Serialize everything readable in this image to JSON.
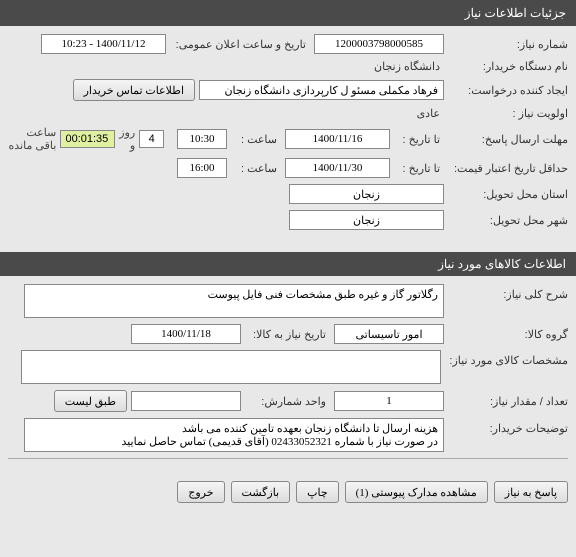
{
  "headers": {
    "main": "جزئیات اطلاعات نیاز",
    "items": "اطلاعات کالاهای مورد نیاز"
  },
  "labels": {
    "need_number": "شماره نیاز:",
    "announce_datetime": "تاریخ و ساعت اعلان عمومی:",
    "buyer_org": "نام دستگاه خریدار:",
    "requester": "ایجاد کننده درخواست:",
    "contact_info": "اطلاعات تماس خریدار",
    "priority": "اولویت نیاز :",
    "response_deadline": "مهلت ارسال پاسخ:",
    "to_date": "تا تاریخ :",
    "time": "ساعت :",
    "remaining_days": "روز و",
    "remaining_time": "ساعت باقی مانده",
    "price_validity": "حداقل تاریخ اعتبار قیمت:",
    "delivery_province": "استان محل تحویل:",
    "delivery_city": "شهر محل تحویل:",
    "need_desc": "شرح کلی نیاز:",
    "item_group": "گروه کالا:",
    "need_date": "تاریخ نیاز به کالا:",
    "item_specs": "مشخصات کالای مورد نیاز:",
    "quantity": "تعداد / مقدار نیاز:",
    "unit": "واحد شمارش:",
    "per_list": "طبق لیست",
    "buyer_notes": "توضیحات خریدار:"
  },
  "values": {
    "need_number": "1200003798000585",
    "announce_datetime": "1400/11/12 - 10:23",
    "buyer_org": "دانشگاه زنجان",
    "requester": "فرهاد مکملی مسئو ل کارپردازی دانشگاه زنجان",
    "priority": "عادی",
    "response_date": "1400/11/16",
    "response_time": "10:30",
    "remaining_days": "4",
    "remaining_time": "00:01:35",
    "price_validity_date": "1400/11/30",
    "price_validity_time": "16:00",
    "delivery_province": "زنجان",
    "delivery_city": "زنجان",
    "need_desc": "رگلاتور گاز و غیره طبق مشخصات فنی فایل پیوست",
    "item_group": "امور تاسیساتی",
    "need_date": "1400/11/18",
    "item_specs": "",
    "quantity": "1",
    "unit": "",
    "buyer_notes": "هزینه ارسال تا دانشگاه زنجان بعهده تامین کننده می باشد\nدر صورت نیاز با شماره 02433052321 (آقای قدیمی) تماس حاصل نمایید"
  },
  "buttons": {
    "respond": "پاسخ به نیاز",
    "attachments": "مشاهده مدارک پیوستی (1)",
    "print": "چاپ",
    "back": "بازگشت",
    "exit": "خروج"
  }
}
